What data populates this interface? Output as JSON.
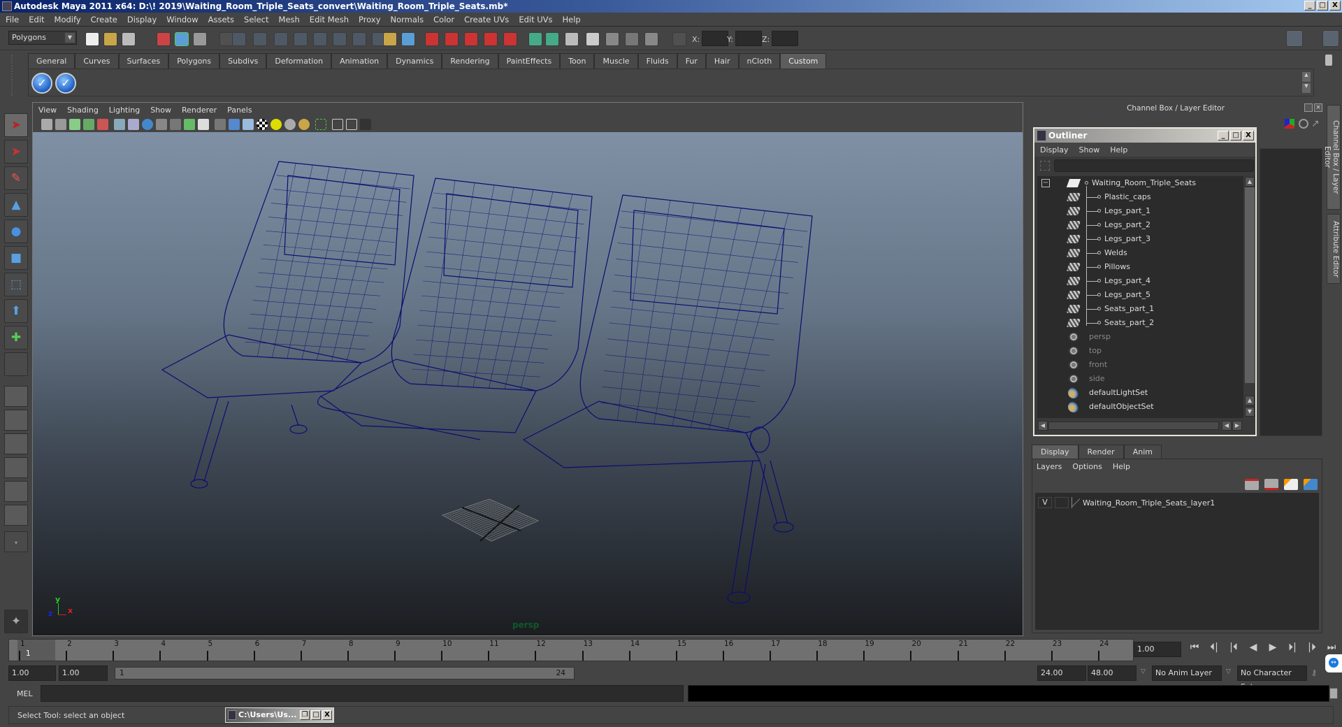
{
  "window": {
    "title": "Autodesk Maya 2011 x64: D:\\! 2019\\Waiting_Room_Triple_Seats_convert\\Waiting_Room_Triple_Seats.mb*",
    "min": "_",
    "max": "□",
    "close": "X"
  },
  "menubar": [
    "File",
    "Edit",
    "Modify",
    "Create",
    "Display",
    "Window",
    "Assets",
    "Select",
    "Mesh",
    "Edit Mesh",
    "Proxy",
    "Normals",
    "Color",
    "Create UVs",
    "Edit UVs",
    "Help"
  ],
  "statusline": {
    "menuset": "Polygons",
    "x_label": "X:",
    "y_label": "Y:",
    "z_label": "Z:",
    "x_value": "",
    "y_value": "",
    "z_value": ""
  },
  "shelf": {
    "tabs": [
      "General",
      "Curves",
      "Surfaces",
      "Polygons",
      "Subdivs",
      "Deformation",
      "Animation",
      "Dynamics",
      "Rendering",
      "PaintEffects",
      "Toon",
      "Muscle",
      "Fluids",
      "Fur",
      "Hair",
      "nCloth",
      "Custom"
    ],
    "active_tab": "Custom",
    "buttons": [
      "check-shelf-button-1",
      "check-shelf-button-2"
    ]
  },
  "toolbox": [
    "select-tool",
    "lasso-tool",
    "paint-select-tool",
    "move-tool",
    "rotate-tool",
    "scale-tool",
    "universal-manipulator",
    "soft-modification-tool",
    "show-manipulator-tool",
    "last-used-tool"
  ],
  "panel": {
    "menus": [
      "View",
      "Shading",
      "Lighting",
      "Show",
      "Renderer",
      "Panels"
    ],
    "camera_label": "persp",
    "axis": {
      "x": "x",
      "y": "y",
      "z": "z"
    }
  },
  "channelbox": {
    "title": "Channel Box / Layer Editor",
    "side_tabs": [
      "Channel Box / Layer Editor",
      "Attribute Editor"
    ]
  },
  "outliner": {
    "title": "Outliner",
    "menus": [
      "Display",
      "Show",
      "Help"
    ],
    "filter": "",
    "root": "Waiting_Room_Triple_Seats",
    "children": [
      "Plastic_caps",
      "Legs_part_1",
      "Legs_part_2",
      "Legs_part_3",
      "Welds",
      "Pillows",
      "Legs_part_4",
      "Legs_part_5",
      "Seats_part_1",
      "Seats_part_2"
    ],
    "cameras": [
      "persp",
      "top",
      "front",
      "side"
    ],
    "sets": [
      "defaultLightSet",
      "defaultObjectSet"
    ]
  },
  "layers": {
    "tabs": [
      "Display",
      "Render",
      "Anim"
    ],
    "active_tab": "Display",
    "menus": [
      "Layers",
      "Options",
      "Help"
    ],
    "items": [
      {
        "visible": "V",
        "name": "Waiting_Room_Triple_Seats_layer1"
      }
    ]
  },
  "timeline": {
    "ticks": [
      "1",
      "2",
      "3",
      "4",
      "5",
      "6",
      "7",
      "8",
      "9",
      "10",
      "11",
      "12",
      "13",
      "14",
      "15",
      "16",
      "17",
      "18",
      "19",
      "20",
      "21",
      "22",
      "23",
      "24"
    ],
    "current_frame_marker": "1",
    "current_time": "1.00"
  },
  "range": {
    "start_time": "1.00",
    "playback_start": "1.00",
    "slider_start": "1",
    "slider_end": "24",
    "playback_end": "24.00",
    "end_time": "48.00",
    "anim_layer": "No Anim Layer",
    "character_set": "No Character Set"
  },
  "playback": [
    "⏮",
    "⏴|",
    "|⏴",
    "◀",
    "▶",
    "⏵|",
    "|⏵",
    "⏭"
  ],
  "commandline": {
    "label": "MEL",
    "input": "",
    "result": ""
  },
  "helpline": {
    "text": "Select Tool: select an object"
  },
  "minimized_window": {
    "title": "C:\\Users\\Us..."
  }
}
